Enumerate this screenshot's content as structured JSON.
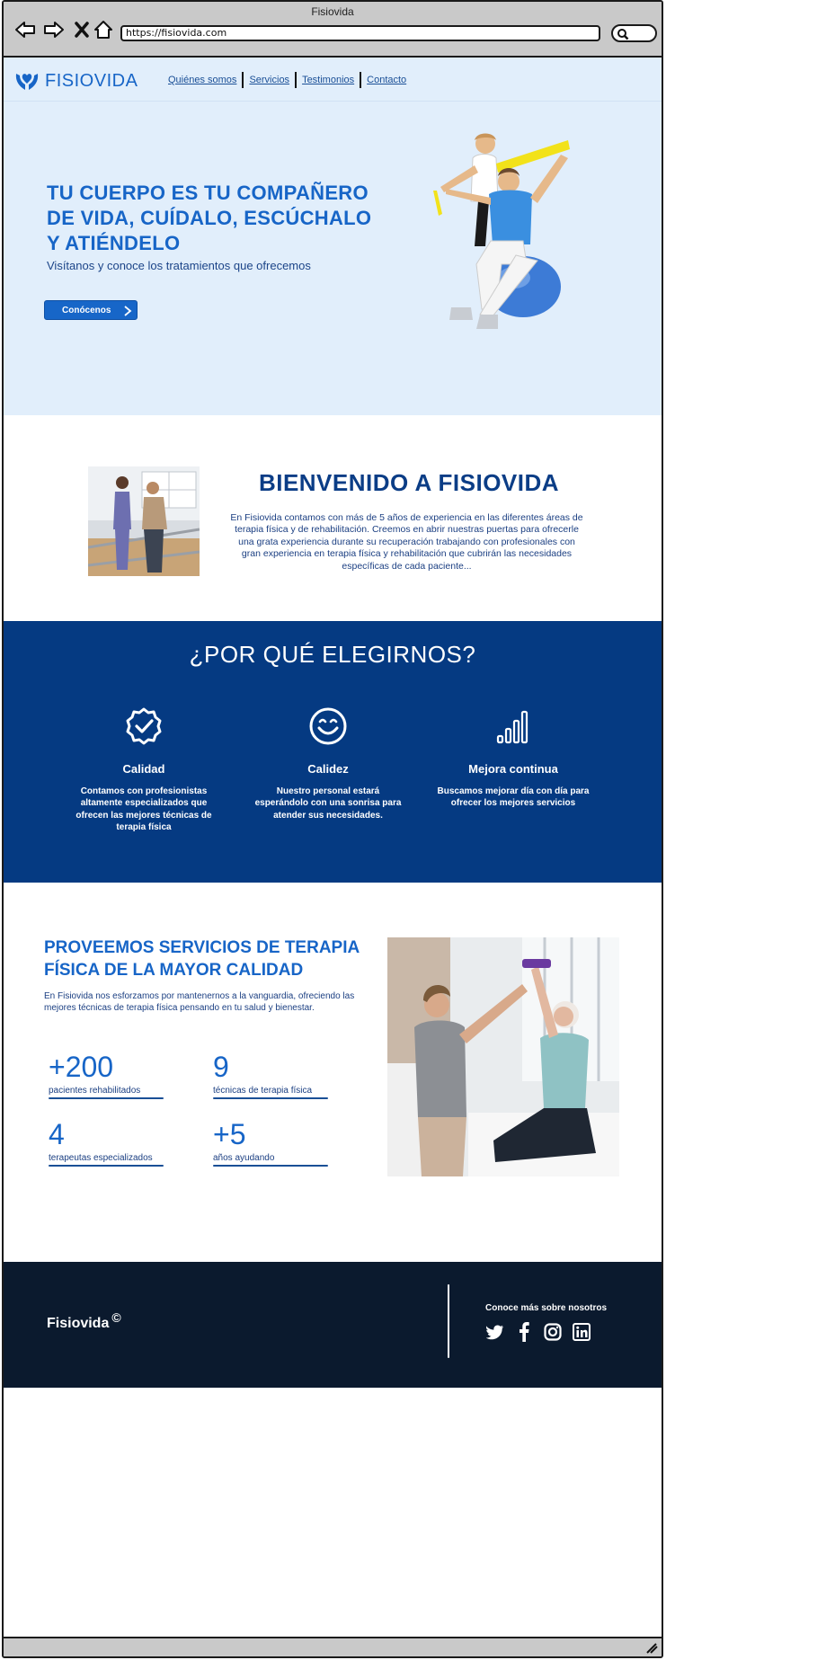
{
  "window": {
    "title": "Fisiovida",
    "url": "https://fisiovida.com"
  },
  "header": {
    "brand": "FISIOVIDA",
    "nav": [
      "Quiénes somos",
      "Servicios",
      "Testimonios",
      "Contacto"
    ]
  },
  "hero": {
    "title": "TU CUERPO ES TU COMPAÑERO DE VIDA, CUÍDALO, ESCÚCHALO Y ATIÉNDELO",
    "subtitle": "Visítanos y conoce los tratamientos que ofrecemos",
    "cta_label": "Conócenos"
  },
  "welcome": {
    "title": "BIENVENIDO A FISIOVIDA",
    "text": "En Fisiovida contamos con más de 5 años de experiencia en las diferentes áreas de terapia física y de rehabilitación. Creemos en abrir nuestras puertas para ofrecerle una grata experiencia durante su recuperación trabajando con profesionales con gran experiencia en terapia física y rehabilitación que cubrirán las necesidades específicas de cada paciente..."
  },
  "why": {
    "title": "¿POR QUÉ ELEGIRNOS?",
    "features": [
      {
        "name": "Calidad",
        "icon": "badge-check-icon",
        "desc": "Contamos con profesionistas altamente especializados que ofrecen las mejores técnicas de terapia física"
      },
      {
        "name": "Calidez",
        "icon": "smile-icon",
        "desc": "Nuestro personal estará esperándolo con una sonrisa para atender sus necesidades."
      },
      {
        "name": "Mejora continua",
        "icon": "signal-bars-icon",
        "desc": "Buscamos mejorar día con día para ofrecer los mejores servicios"
      }
    ]
  },
  "services": {
    "title": "PROVEEMOS SERVICIOS DE TERAPIA FÍSICA DE LA MAYOR CALIDAD",
    "text": "En Fisiovida nos esforzamos por mantenernos a la vanguardia, ofreciendo las mejores técnicas de terapia física pensando en tu salud y bienestar.",
    "stats": [
      {
        "num": "+200",
        "label": "pacientes rehabilitados"
      },
      {
        "num": "9",
        "label": "técnicas de terapia física"
      },
      {
        "num": "4",
        "label": "terapeutas especializados"
      },
      {
        "num": "+5",
        "label": "años ayudando"
      }
    ]
  },
  "footer": {
    "brand": "Fisiovida",
    "copyright_symbol": "©",
    "caption": "Conoce más sobre nosotros",
    "socials": [
      "twitter-icon",
      "facebook-icon",
      "instagram-icon",
      "linkedin-icon"
    ]
  },
  "colors": {
    "primary": "#1765c7",
    "dark_blue": "#053a82",
    "hero_bg": "#e1eefb",
    "footer_bg": "#0b1a2e"
  }
}
